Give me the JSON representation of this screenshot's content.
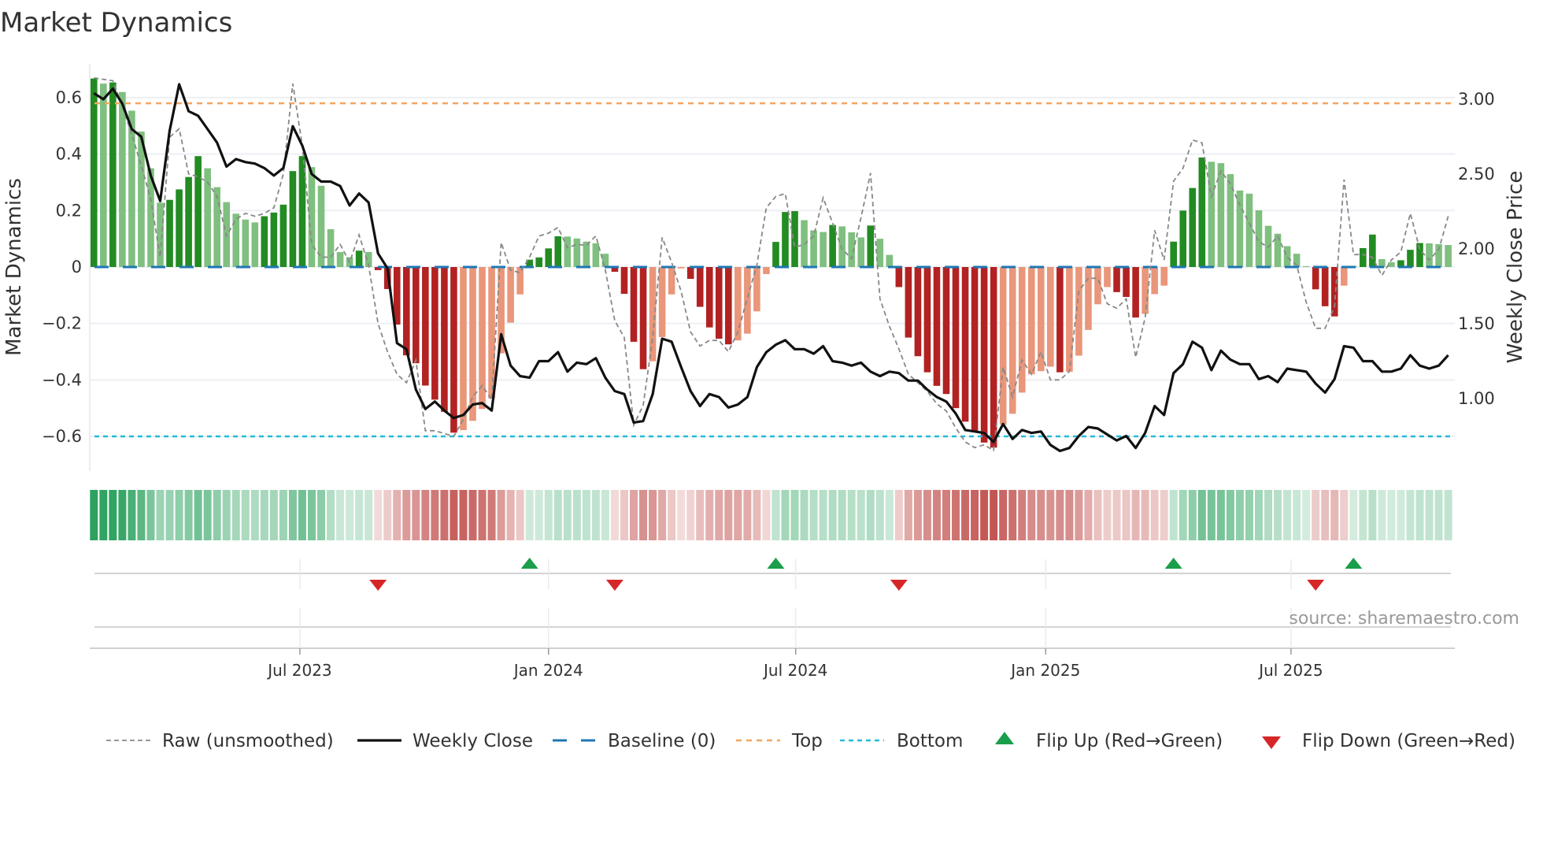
{
  "title": "Market Dynamics",
  "source": "source: sharemaestro.com",
  "chart_data": {
    "type": "bar",
    "title": "Market Dynamics",
    "ylabel": "Market Dynamics",
    "y2label": "Weekly Close Price",
    "ylim": [
      -0.72,
      0.72
    ],
    "y2lim": [
      0.52,
      3.27
    ],
    "yticks": [
      {
        "v": 0.6,
        "label": "0.6"
      },
      {
        "v": 0.4,
        "label": "0.4"
      },
      {
        "v": 0.2,
        "label": "0.2"
      },
      {
        "v": 0,
        "label": "0"
      },
      {
        "v": -0.2,
        "label": "−0.2"
      },
      {
        "v": -0.4,
        "label": "−0.4"
      },
      {
        "v": -0.6,
        "label": "−0.6"
      }
    ],
    "y2ticks": [
      {
        "v": 3.0,
        "label": "3.00"
      },
      {
        "v": 2.5,
        "label": "2.50"
      },
      {
        "v": 2.0,
        "label": "2.00"
      },
      {
        "v": 1.5,
        "label": "1.50"
      },
      {
        "v": 1.0,
        "label": "1.00"
      }
    ],
    "xticks": [
      {
        "week": 22.75,
        "label": "Jul 2023"
      },
      {
        "week": 49.0,
        "label": "Jan 2024"
      },
      {
        "week": 75.1,
        "label": "Jul 2024"
      },
      {
        "week": 101.5,
        "label": "Jan 2025"
      },
      {
        "week": 127.4,
        "label": "Jul 2025"
      }
    ],
    "grid": true,
    "top_level": 0.58,
    "bottom_level": -0.6,
    "baseline": 0,
    "momentum": [
      0.668,
      0.65,
      0.654,
      0.62,
      0.554,
      0.48,
      0.35,
      0.228,
      0.238,
      0.275,
      0.319,
      0.393,
      0.35,
      0.283,
      0.23,
      0.189,
      0.168,
      0.158,
      0.18,
      0.193,
      0.221,
      0.34,
      0.393,
      0.354,
      0.288,
      0.134,
      0.053,
      0.035,
      0.058,
      0.053,
      -0.011,
      -0.078,
      -0.204,
      -0.313,
      -0.341,
      -0.42,
      -0.47,
      -0.513,
      -0.587,
      -0.578,
      -0.545,
      -0.503,
      -0.466,
      -0.306,
      -0.197,
      -0.097,
      0.026,
      0.034,
      0.066,
      0.109,
      0.108,
      0.101,
      0.09,
      0.084,
      0.047,
      -0.017,
      -0.095,
      -0.265,
      -0.362,
      -0.334,
      -0.248,
      -0.097,
      -0.005,
      -0.042,
      -0.141,
      -0.214,
      -0.254,
      -0.274,
      -0.26,
      -0.236,
      -0.157,
      -0.025,
      0.089,
      0.195,
      0.198,
      0.166,
      0.13,
      0.124,
      0.149,
      0.144,
      0.123,
      0.105,
      0.147,
      0.1,
      0.043,
      -0.071,
      -0.25,
      -0.316,
      -0.373,
      -0.421,
      -0.45,
      -0.5,
      -0.548,
      -0.583,
      -0.622,
      -0.64,
      -0.558,
      -0.52,
      -0.445,
      -0.38,
      -0.369,
      -0.353,
      -0.373,
      -0.371,
      -0.314,
      -0.223,
      -0.132,
      -0.071,
      -0.089,
      -0.106,
      -0.179,
      -0.166,
      -0.096,
      -0.066,
      0.09,
      0.2,
      0.28,
      0.388,
      0.373,
      0.368,
      0.329,
      0.271,
      0.26,
      0.201,
      0.146,
      0.118,
      0.074,
      0.047,
      0.003,
      -0.079,
      -0.139,
      -0.175,
      -0.066,
      0.002,
      0.067,
      0.115,
      0.028,
      0.017,
      0.024,
      0.061,
      0.085,
      0.084,
      0.081,
      0.078
    ],
    "raw": [
      0.67,
      0.665,
      0.66,
      0.57,
      0.47,
      0.36,
      0.24,
      0.035,
      0.46,
      0.49,
      0.33,
      0.32,
      0.3,
      0.25,
      0.11,
      0.17,
      0.19,
      0.18,
      0.19,
      0.21,
      0.33,
      0.65,
      0.43,
      0.08,
      0.035,
      0.035,
      0.08,
      0.017,
      0.114,
      0.007,
      -0.2,
      -0.3,
      -0.38,
      -0.41,
      -0.33,
      -0.58,
      -0.58,
      -0.59,
      -0.6,
      -0.54,
      -0.46,
      -0.42,
      -0.47,
      0.087,
      -0.011,
      -0.02,
      0.035,
      0.11,
      0.12,
      0.14,
      0.068,
      0.08,
      0.077,
      0.11,
      -0.01,
      -0.19,
      -0.25,
      -0.56,
      -0.49,
      -0.25,
      0.105,
      0.017,
      -0.086,
      -0.23,
      -0.28,
      -0.26,
      -0.26,
      -0.3,
      -0.23,
      -0.11,
      0.007,
      0.21,
      0.25,
      0.26,
      0.07,
      0.08,
      0.11,
      0.245,
      0.156,
      0.063,
      0.03,
      0.175,
      0.333,
      -0.113,
      -0.21,
      -0.29,
      -0.38,
      -0.41,
      -0.44,
      -0.485,
      -0.51,
      -0.57,
      -0.62,
      -0.64,
      -0.63,
      -0.65,
      -0.355,
      -0.46,
      -0.33,
      -0.38,
      -0.3,
      -0.4,
      -0.4,
      -0.37,
      -0.085,
      -0.04,
      -0.04,
      -0.13,
      -0.146,
      -0.113,
      -0.32,
      -0.18,
      0.13,
      0.025,
      0.304,
      0.35,
      0.45,
      0.44,
      0.25,
      0.34,
      0.295,
      0.22,
      0.155,
      0.09,
      0.07,
      0.11,
      0.034,
      0.007,
      -0.124,
      -0.217,
      -0.217,
      -0.14,
      0.31,
      0.044,
      0.044,
      0.034,
      -0.03,
      0.025,
      0.053,
      0.19,
      0.062,
      0.025,
      0.062,
      0.18
    ],
    "close": [
      3.04,
      3.0,
      3.07,
      2.97,
      2.8,
      2.75,
      2.49,
      2.32,
      2.79,
      3.1,
      2.92,
      2.89,
      2.8,
      2.71,
      2.55,
      2.6,
      2.58,
      2.57,
      2.54,
      2.49,
      2.54,
      2.82,
      2.69,
      2.5,
      2.45,
      2.45,
      2.42,
      2.29,
      2.37,
      2.31,
      1.97,
      1.87,
      1.37,
      1.33,
      1.06,
      0.93,
      0.98,
      0.92,
      0.87,
      0.89,
      0.96,
      0.97,
      0.92,
      1.43,
      1.22,
      1.15,
      1.14,
      1.25,
      1.25,
      1.31,
      1.18,
      1.24,
      1.23,
      1.27,
      1.14,
      1.05,
      1.03,
      0.84,
      0.85,
      1.03,
      1.4,
      1.38,
      1.21,
      1.05,
      0.95,
      1.03,
      1.01,
      0.94,
      0.96,
      1.01,
      1.21,
      1.31,
      1.36,
      1.39,
      1.33,
      1.33,
      1.3,
      1.35,
      1.25,
      1.24,
      1.22,
      1.24,
      1.18,
      1.15,
      1.18,
      1.17,
      1.12,
      1.12,
      1.06,
      1.01,
      0.98,
      0.9,
      0.79,
      0.78,
      0.77,
      0.71,
      0.83,
      0.73,
      0.79,
      0.77,
      0.78,
      0.69,
      0.65,
      0.67,
      0.75,
      0.81,
      0.8,
      0.76,
      0.72,
      0.75,
      0.67,
      0.77,
      0.95,
      0.89,
      1.17,
      1.23,
      1.38,
      1.34,
      1.19,
      1.32,
      1.26,
      1.23,
      1.23,
      1.13,
      1.15,
      1.11,
      1.2,
      1.19,
      1.18,
      1.1,
      1.04,
      1.13,
      1.35,
      1.34,
      1.25,
      1.25,
      1.18,
      1.18,
      1.2,
      1.29,
      1.22,
      1.2,
      1.22,
      1.29
    ],
    "flip_up_weeks": [
      47,
      73,
      115,
      134
    ],
    "flip_down_weeks": [
      31,
      56,
      86,
      130
    ],
    "legend": {
      "placement": "bottom",
      "items": [
        "Raw (unsmoothed)",
        "Weekly Close",
        "Baseline (0)",
        "Top",
        "Bottom",
        "Flip Up (Red→Green)",
        "Flip Down (Green→Red)"
      ]
    },
    "colors": {
      "up_strong": "#228b22",
      "up_weak": "#7fbf7f",
      "down_strong": "#b22222",
      "down_weak": "#e9967a",
      "close": "#111111",
      "raw": "#888888",
      "baseline": "#1f77b4",
      "top": "#f4a460",
      "bottom": "#22bcd4",
      "flip_up": "#1a9e4a",
      "flip_down": "#d62728",
      "heat_green": "#2ca25f",
      "heat_red": "#c0504d"
    }
  }
}
